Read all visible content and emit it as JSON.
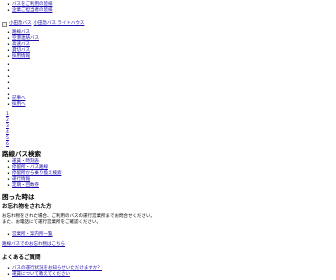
{
  "top_links": [
    "バスをご利用の皆様",
    "企業ご担当者の皆様"
  ],
  "header": {
    "logo_alt": "小田急バス",
    "site_title": "小田急バス ライトハウス"
  },
  "main_nav": [
    "路線バス",
    "空港連絡バス",
    "高速バス",
    "貸切バス",
    "採用情報"
  ],
  "blank_bullets": 6,
  "sub_links": [
    "記事へ",
    "採用へ"
  ],
  "numbered": [
    "1",
    "2",
    "3",
    "4",
    "5",
    "6"
  ],
  "route_search": {
    "heading": "路線バス検索",
    "items": [
      "運賃・時刻表",
      "停留所・バス路線",
      "停留所から乗り換え検索",
      "運行情報",
      "定期・回数券"
    ]
  },
  "trouble": {
    "heading": "困った時は",
    "lost_heading": "お忘れ物をされた方",
    "lost_text_1": "お忘れ物をされた場合、ご利用のバスの運行営業所までお問合せください。",
    "lost_text_2": "また、お電話にて運行営業所をご確認ください。",
    "office_link": "営業所・案内所一覧",
    "more_link": "路線バスでのお忘れ物はこちら"
  },
  "faq": {
    "heading": "よくあるご質問",
    "items": [
      "バスの運行状況をお知らせいただけますか？",
      "運賃について教えてください"
    ]
  }
}
